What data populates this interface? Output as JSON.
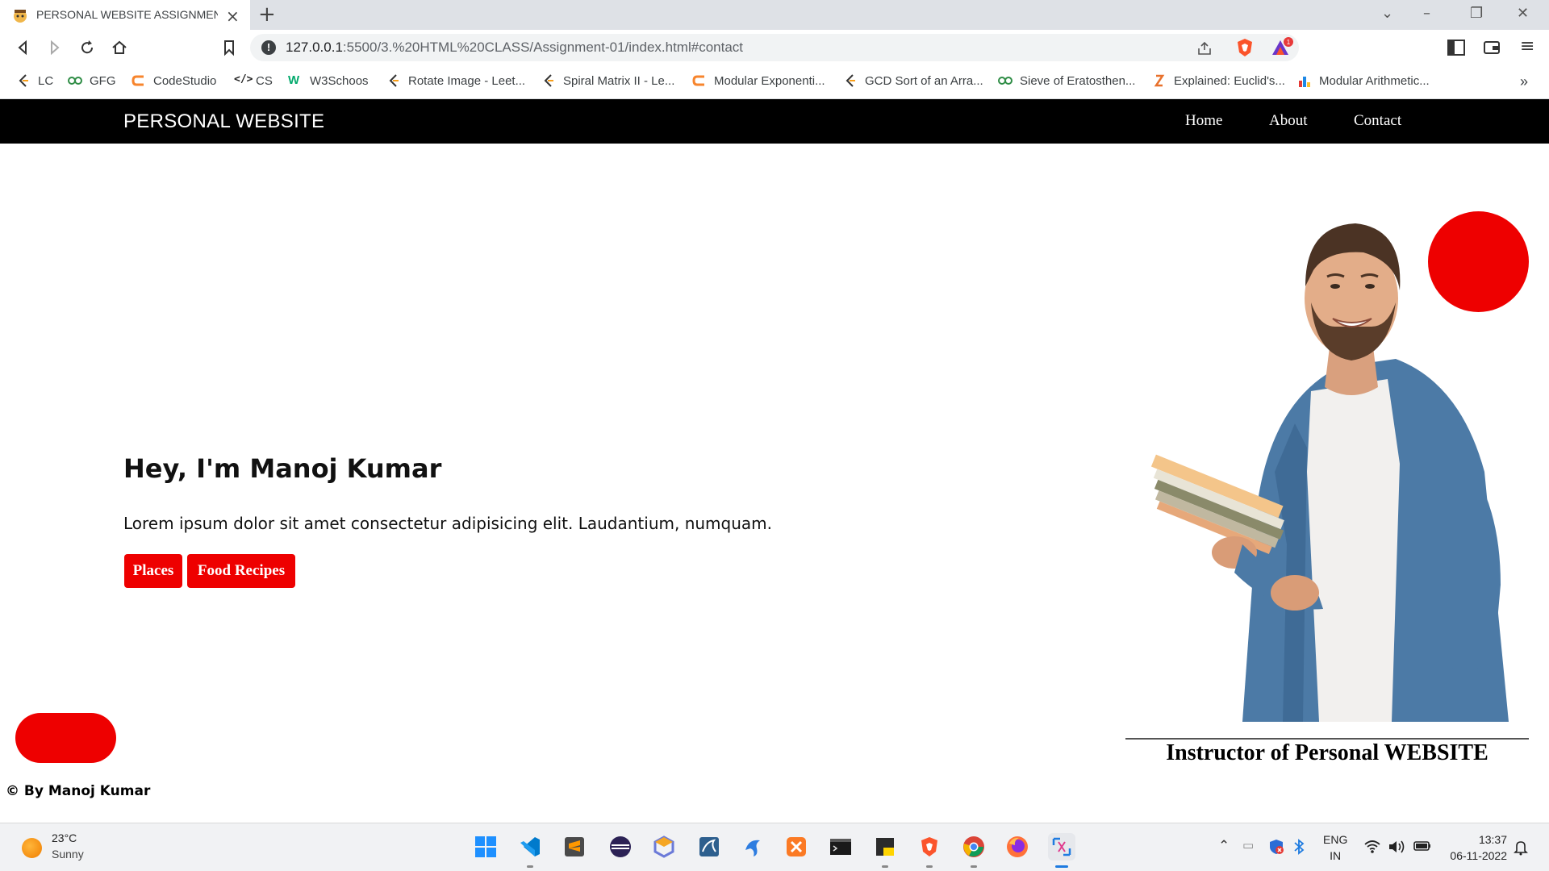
{
  "browser": {
    "tab_title": "PERSONAL WEBSITE ASSIGNMENT",
    "url_host": "127.0.0.1",
    "url_rest": ":5500/3.%20HTML%20CLASS/Assignment-01/index.html#contact",
    "bookmarks": [
      {
        "label": "LC",
        "icon": "leetcode-icon"
      },
      {
        "label": "GFG",
        "icon": "gfg-icon"
      },
      {
        "label": "CodeStudio",
        "icon": "codestudio-icon"
      },
      {
        "label": "CS",
        "icon": "code-icon"
      },
      {
        "label": "W3Schoos",
        "icon": "w3schools-icon"
      },
      {
        "label": "Rotate Image - Leet...",
        "icon": "leetcode-icon"
      },
      {
        "label": "Spiral Matrix II - Le...",
        "icon": "leetcode-icon"
      },
      {
        "label": "Modular Exponenti...",
        "icon": "codestudio-icon"
      },
      {
        "label": "GCD Sort of an Arra...",
        "icon": "leetcode-icon"
      },
      {
        "label": "Sieve of Eratosthen...",
        "icon": "gfg-icon"
      },
      {
        "label": "Explained: Euclid's...",
        "icon": "scaler-icon"
      },
      {
        "label": "Modular Arithmetic...",
        "icon": "chart-icon"
      }
    ],
    "more_bookmarks": "»"
  },
  "site": {
    "brand": "PERSONAL WEBSITE",
    "nav": [
      "Home",
      "About",
      "Contact"
    ],
    "hero_title": "Hey, I'm Manoj Kumar",
    "hero_text": "Lorem ipsum dolor sit amet consectetur adipisicing elit. Laudantium, numquam.",
    "buttons": [
      "Places",
      "Food Recipes"
    ],
    "caption": "Instructor of Personal WEBSITE",
    "footer": "© By Manoj Kumar",
    "accent_color": "#ee0000",
    "nav_bg": "#000000"
  },
  "taskbar": {
    "temperature": "23°C",
    "condition": "Sunny",
    "apps": [
      "windows-start-icon",
      "vscode-icon",
      "sublime-icon",
      "eclipse-icon",
      "cube-icon",
      "mysql-icon",
      "dolphin-icon",
      "xampp-icon",
      "terminal-icon",
      "sticky-notes-icon",
      "brave-icon",
      "chrome-icon",
      "firefox-icon",
      "snipping-tool-icon"
    ],
    "lang_line1": "ENG",
    "lang_line2": "IN",
    "time": "13:37",
    "date": "06-11-2022"
  }
}
